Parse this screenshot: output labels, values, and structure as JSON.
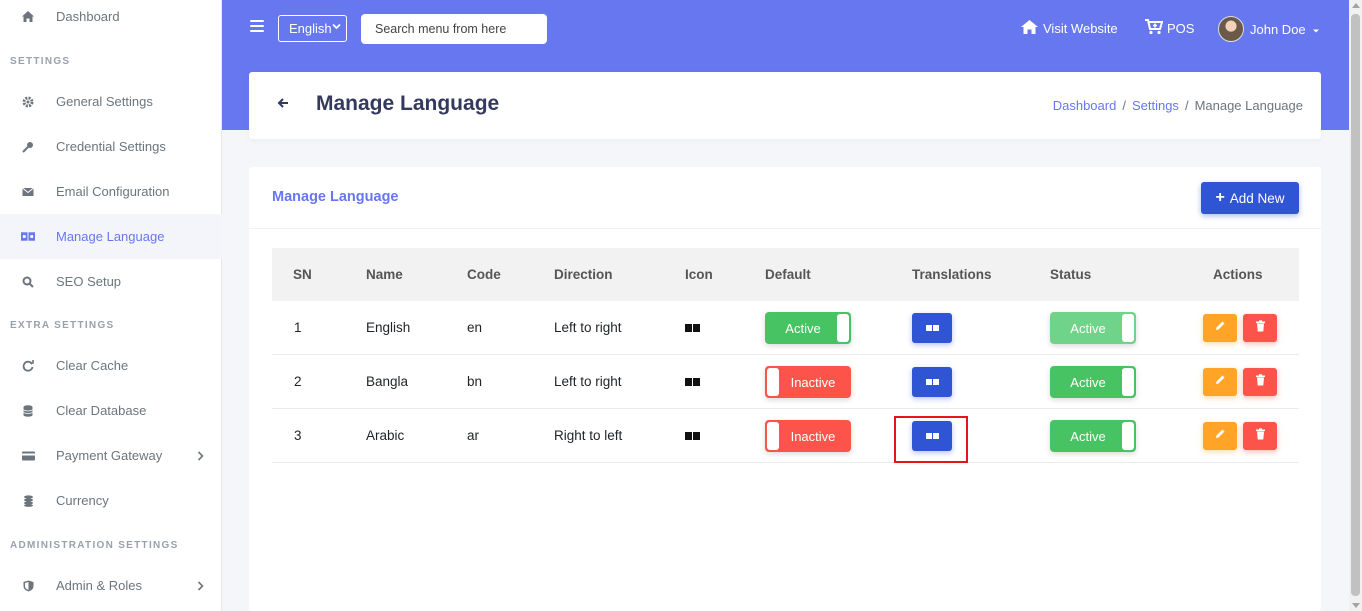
{
  "sidebar": {
    "dashboard": {
      "label": "Dashboard",
      "icon": "home-icon"
    },
    "section_settings": "SETTINGS",
    "general_settings": {
      "label": "General Settings",
      "icon": "gear-icon"
    },
    "credential_settings": {
      "label": "Credential Settings",
      "icon": "key-icon"
    },
    "email_configuration": {
      "label": "Email Configuration",
      "icon": "envelope-icon"
    },
    "manage_language": {
      "label": "Manage Language",
      "icon": "language-icon"
    },
    "seo_setup": {
      "label": "SEO Setup",
      "icon": "search-icon"
    },
    "section_extra": "EXTRA SETTINGS",
    "clear_cache": {
      "label": "Clear Cache",
      "icon": "refresh-icon"
    },
    "clear_database": {
      "label": "Clear Database",
      "icon": "database-icon"
    },
    "payment_gateway": {
      "label": "Payment Gateway",
      "icon": "credit-card-icon"
    },
    "currency": {
      "label": "Currency",
      "icon": "coins-icon"
    },
    "section_admin": "ADMINISTRATION SETTINGS",
    "admin_roles": {
      "label": "Admin & Roles",
      "icon": "shield-icon"
    }
  },
  "header": {
    "language_selected": "English",
    "search_placeholder": "Search menu from here",
    "visit_website": "Visit Website",
    "pos": "POS",
    "user_name": "John Doe"
  },
  "page": {
    "title": "Manage Language",
    "breadcrumb": [
      "Dashboard",
      "Settings",
      "Manage Language"
    ],
    "breadcrumb_sep": "/"
  },
  "card": {
    "title": "Manage Language",
    "add_button": "Add New"
  },
  "table": {
    "columns": [
      "SN",
      "Name",
      "Code",
      "Direction",
      "Icon",
      "Default",
      "Translations",
      "Status",
      "Actions"
    ],
    "rows": [
      {
        "sn": "1",
        "name": "English",
        "code": "en",
        "direction": "Left to right",
        "default": "Active",
        "status": "Active"
      },
      {
        "sn": "2",
        "name": "Bangla",
        "code": "bn",
        "direction": "Left to right",
        "default": "Inactive",
        "status": "Active"
      },
      {
        "sn": "3",
        "name": "Arabic",
        "code": "ar",
        "direction": "Right to left",
        "default": "Inactive",
        "status": "Active"
      }
    ]
  },
  "colors": {
    "primary": "#6777ef",
    "blue_button": "#2f55d4",
    "success": "#47c363",
    "danger": "#fc544b",
    "warning": "#ffa426",
    "highlight": "#e8141b"
  }
}
